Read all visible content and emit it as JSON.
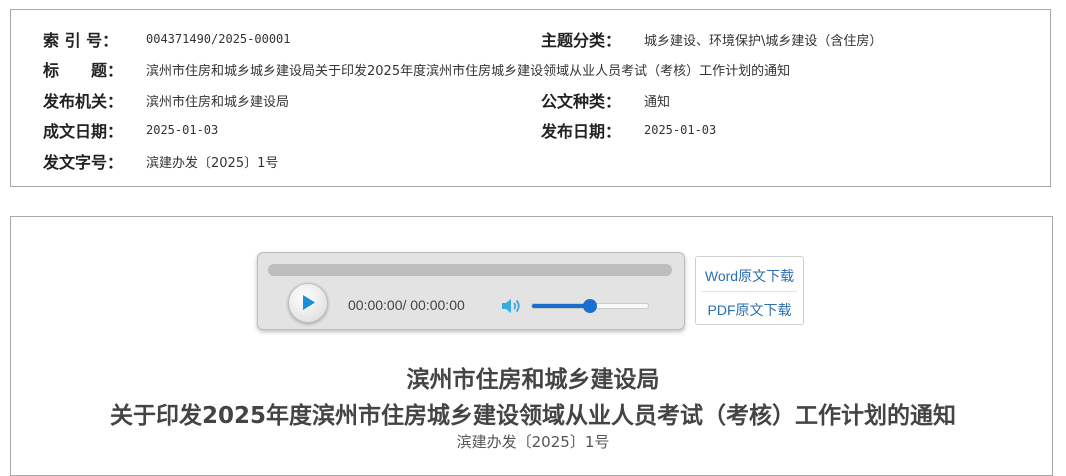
{
  "meta": {
    "index_label": "索 引 号：",
    "index_value": "004371490/2025-00001",
    "topic_label": "主题分类：",
    "topic_value": "城乡建设、环境保护\\城乡建设（含住房）",
    "title_label": "标　　题：",
    "title_value": "滨州市住房和城乡城乡建设局关于印发2025年度滨州市住房城乡建设领域从业人员考试（考核）工作计划的通知",
    "issuer_label": "发布机关：",
    "issuer_value": "滨州市住房和城乡建设局",
    "doctype_label": "公文种类：",
    "doctype_value": "通知",
    "written_label": "成文日期：",
    "written_value": "2025-01-03",
    "published_label": "发布日期：",
    "published_value": "2025-01-03",
    "docno_label": "发文字号：",
    "docno_value": "滨建办发〔2025〕1号"
  },
  "player": {
    "time": "00:00:00/ 00:00:00",
    "progress": 0,
    "volume": 0.5
  },
  "downloads": {
    "word": "Word原文下载",
    "pdf": "PDF原文下载"
  },
  "document": {
    "title_line1": "滨州市住房和城乡建设局",
    "title_line2": "关于印发2025年度滨州市住房城乡建设领域从业人员考试（考核）工作计划的通知",
    "doc_number": "滨建办发〔2025〕1号"
  },
  "colors": {
    "accent": "#1a6fcc",
    "link": "#2d6fb0"
  }
}
